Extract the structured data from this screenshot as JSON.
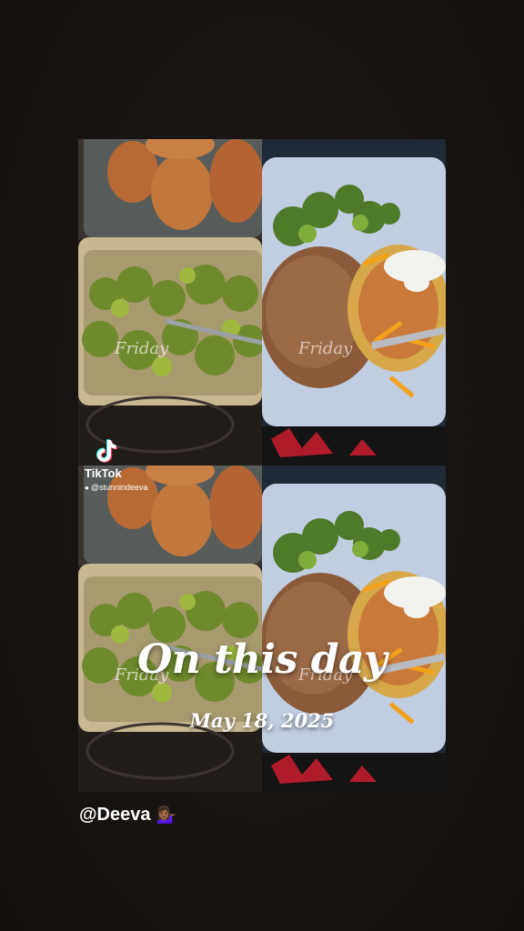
{
  "tiktok": {
    "brand": "TikTok",
    "username": "@stunnindeeva"
  },
  "photo_watermark": "Friday",
  "memory": {
    "title": "On this day",
    "date": "May 18, 2025"
  },
  "mention": {
    "handle": "@Deeva",
    "emoji": "💁🏾‍♀️"
  },
  "colors": {
    "background": "#171311",
    "text": "#ffffff"
  }
}
